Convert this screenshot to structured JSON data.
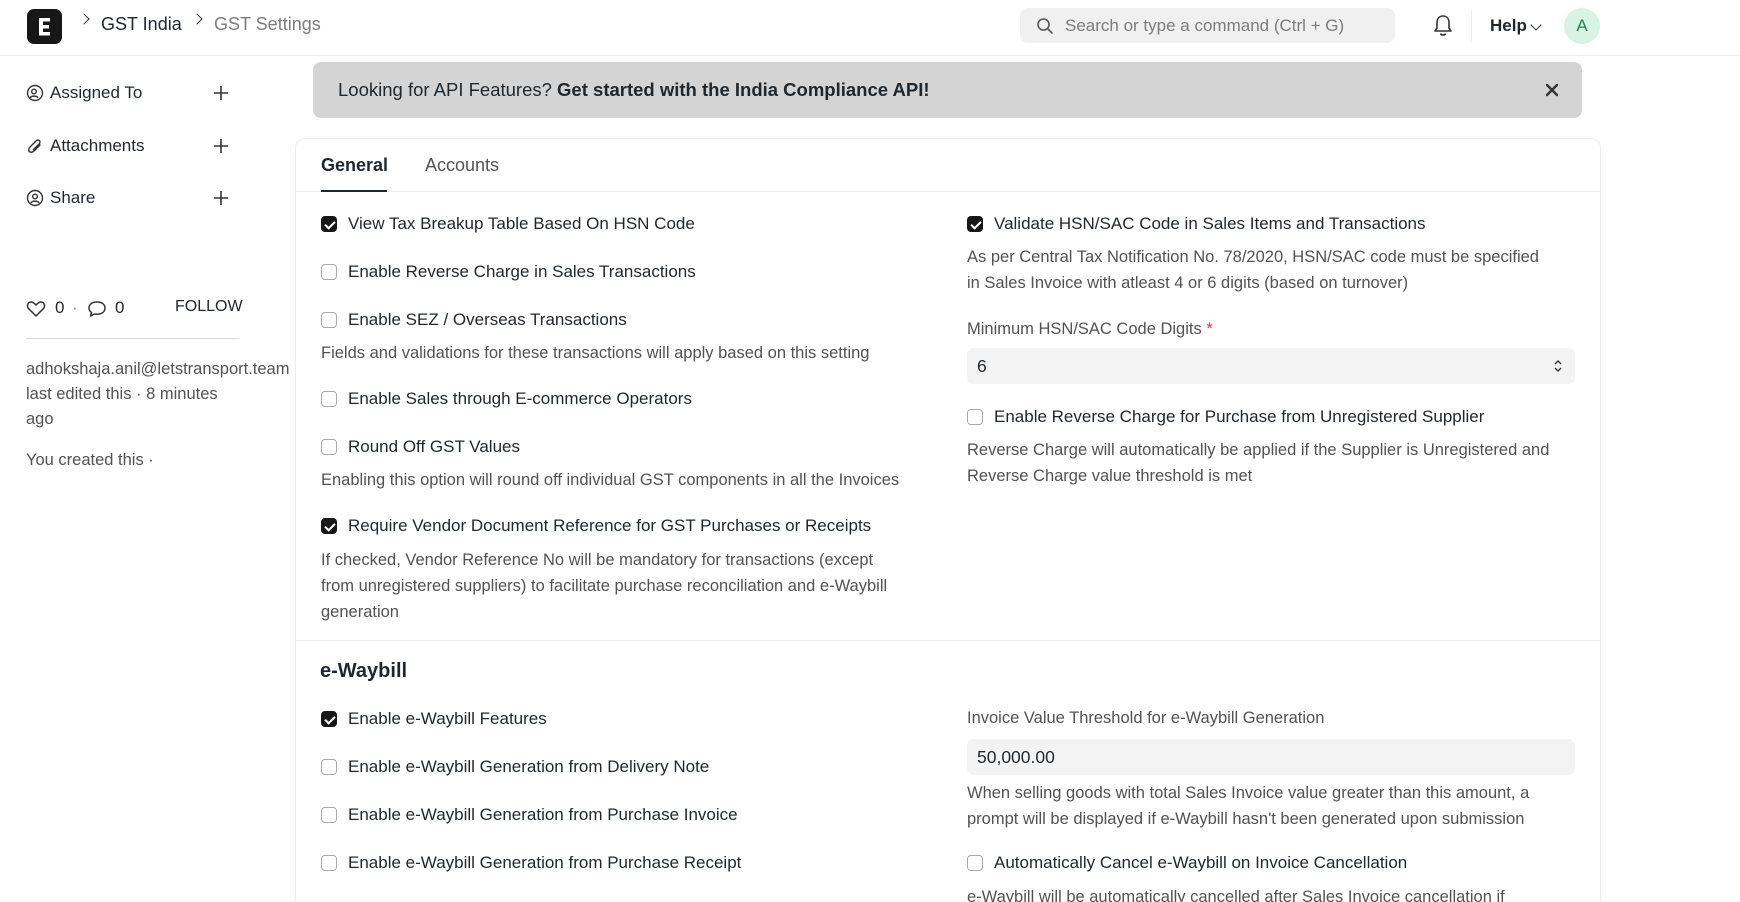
{
  "navbar": {
    "breadcrumbs": [
      "GST India",
      "GST Settings"
    ],
    "search_placeholder": "Search or type a command (Ctrl + G)",
    "help_label": "Help",
    "avatar_initial": "A"
  },
  "sidebar": {
    "assigned_to": "Assigned To",
    "attachments": "Attachments",
    "share": "Share",
    "likes": "0",
    "comments": "0",
    "follow": "FOLLOW",
    "edited_by": "adhokshaja.anil@letstransport.team",
    "edited_when": "last edited this · 8 minutes ago",
    "created": "You created this ·"
  },
  "banner": {
    "lead": "Looking for API Features?",
    "cta": "Get started with the India Compliance API!"
  },
  "tabs": {
    "general": "General",
    "accounts": "Accounts"
  },
  "general": {
    "hsn_breakup": {
      "label": "View Tax Breakup Table Based On HSN Code",
      "checked": true
    },
    "reverse_charge_sales": {
      "label": "Enable Reverse Charge in Sales Transactions",
      "checked": false
    },
    "sez": {
      "label": "Enable SEZ / Overseas Transactions",
      "checked": false,
      "desc": "Fields and validations for these transactions will apply based on this setting"
    },
    "ecommerce": {
      "label": "Enable Sales through E-commerce Operators",
      "checked": false
    },
    "round_off": {
      "label": "Round Off GST Values",
      "checked": false,
      "desc": "Enabling this option will round off individual GST components in all the Invoices"
    },
    "vendor_ref": {
      "label": "Require Vendor Document Reference for GST Purchases or Receipts",
      "checked": true,
      "desc_1": "If checked, Vendor Reference No will be mandatory for transactions (except",
      "desc_2": "from unregistered suppliers) to facilitate purchase reconciliation and e-Waybill",
      "desc_3": "generation"
    },
    "validate_hsn": {
      "label": "Validate HSN/SAC Code in Sales Items and Transactions",
      "checked": true,
      "desc_1": "As per Central Tax Notification No. 78/2020, HSN/SAC code must be specified",
      "desc_2": "in Sales Invoice with atleast 4 or 6 digits (based on turnover)"
    },
    "min_hsn_label": "Minimum HSN/SAC Code Digits",
    "min_hsn_required": "*",
    "min_hsn_value": "6",
    "reverse_charge_purchase": {
      "label": "Enable Reverse Charge for Purchase from Unregistered Supplier",
      "checked": false,
      "desc_1": "Reverse Charge will automatically be applied if the Supplier is Unregistered and",
      "desc_2": "Reverse Charge value threshold is met"
    }
  },
  "ewaybill": {
    "title": "e-Waybill",
    "enable": {
      "label": "Enable e-Waybill Features",
      "checked": true
    },
    "delivery_note": {
      "label": "Enable e-Waybill Generation from Delivery Note",
      "checked": false
    },
    "purchase_invoice": {
      "label": "Enable e-Waybill Generation from Purchase Invoice",
      "checked": false
    },
    "purchase_receipt": {
      "label": "Enable e-Waybill Generation from Purchase Receipt",
      "checked": false
    },
    "threshold_label": "Invoice Value Threshold for e-Waybill Generation",
    "threshold_value": "50,000.00",
    "threshold_desc_1": "When selling goods with total Sales Invoice value greater than this amount, a",
    "threshold_desc_2": "prompt will be displayed if e-Waybill hasn't been generated upon submission",
    "auto_cancel": {
      "label": "Automatically Cancel e-Waybill on Invoice Cancellation",
      "checked": false,
      "desc": "e-Waybill will be automatically cancelled after Sales Invoice cancellation if"
    }
  }
}
